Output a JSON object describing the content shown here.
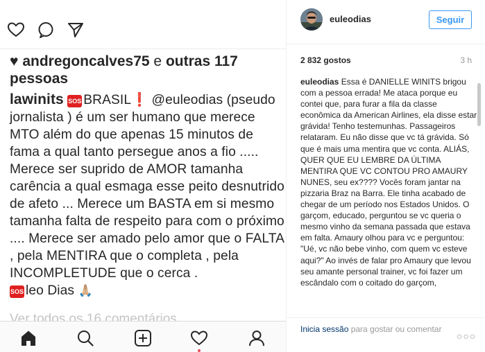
{
  "left": {
    "likes": {
      "user": "andregoncalves75",
      "connector": "e",
      "others": "outras 117",
      "suffix": "pessoas"
    },
    "caption": {
      "author": "lawinits",
      "sos_label": "SOS",
      "brasil": "BRASIL",
      "exclamation": "❗",
      "text": " @euleodias (pseudo jornalista ) é um ser humano que merece MTO além do que apenas 15 minutos de fama a qual tanto persegue anos a fio ..... Merece ser suprido de AMOR tamanha carência a qual esmaga esse peito desnutrido de afeto ... Merece um BASTA em si mesmo tamanha falta de respeito para com o próximo .... Merece ser amado pelo amor que o FALTA , pela MENTIRA que o completa , pela INCOMPLETUDE  que o cerca .",
      "signature": "leo Dias",
      "pray_emoji": "🙏🏼"
    },
    "view_all": "Ver todos os 16 comentários",
    "icons": {
      "like": "heart-icon",
      "comment": "comment-icon",
      "share": "share-icon",
      "home": "home-icon",
      "search": "search-icon",
      "add": "add-post-icon",
      "activity": "activity-heart-icon",
      "profile": "profile-icon"
    }
  },
  "right": {
    "username": "euleodias",
    "follow_label": "Seguir",
    "likes_count": "2 832 gostos",
    "time_ago": "3 h",
    "comment": {
      "author": "euleodias",
      "text": " Essa é DANIELLE WINITS brigou com a pessoa errada! Me ataca porque eu contei que, para furar a fila da classe econômica da American Airlines, ela disse estar grávida! Tenho testemunhas. Passageiros relataram. Eu não disse que vc tá grávida. Só que é mais uma mentira que vc conta. ALIÁS, QUER QUE EU LEMBRE DA ÚLTIMA MENTIRA QUE VC CONTOU PRO AMAURY NUNES, seu ex???? Vocês foram jantar na pizzaria Braz na Barra. Ele tinha acabado de chegar de um período nos Estados Unidos. O garçom, educado, perguntou se vc queria o mesmo vinho da semana passada que estava em falta. Amaury olhou para vc e perguntou: \"Ué, vc não bebe vinho, com quem vc esteve aqui?\" Ao invés de falar pro Amaury que levou seu amante personal trainer, vc foi fazer um escândalo com o coitado do garçom,"
    },
    "footer": {
      "login_link": "Inicia sessão",
      "login_rest": " para gostar ou comentar",
      "more": "○○○"
    },
    "colors": {
      "accent": "#3897f0",
      "link": "#003569",
      "muted": "#999999",
      "sos_red": "#e02020"
    }
  }
}
